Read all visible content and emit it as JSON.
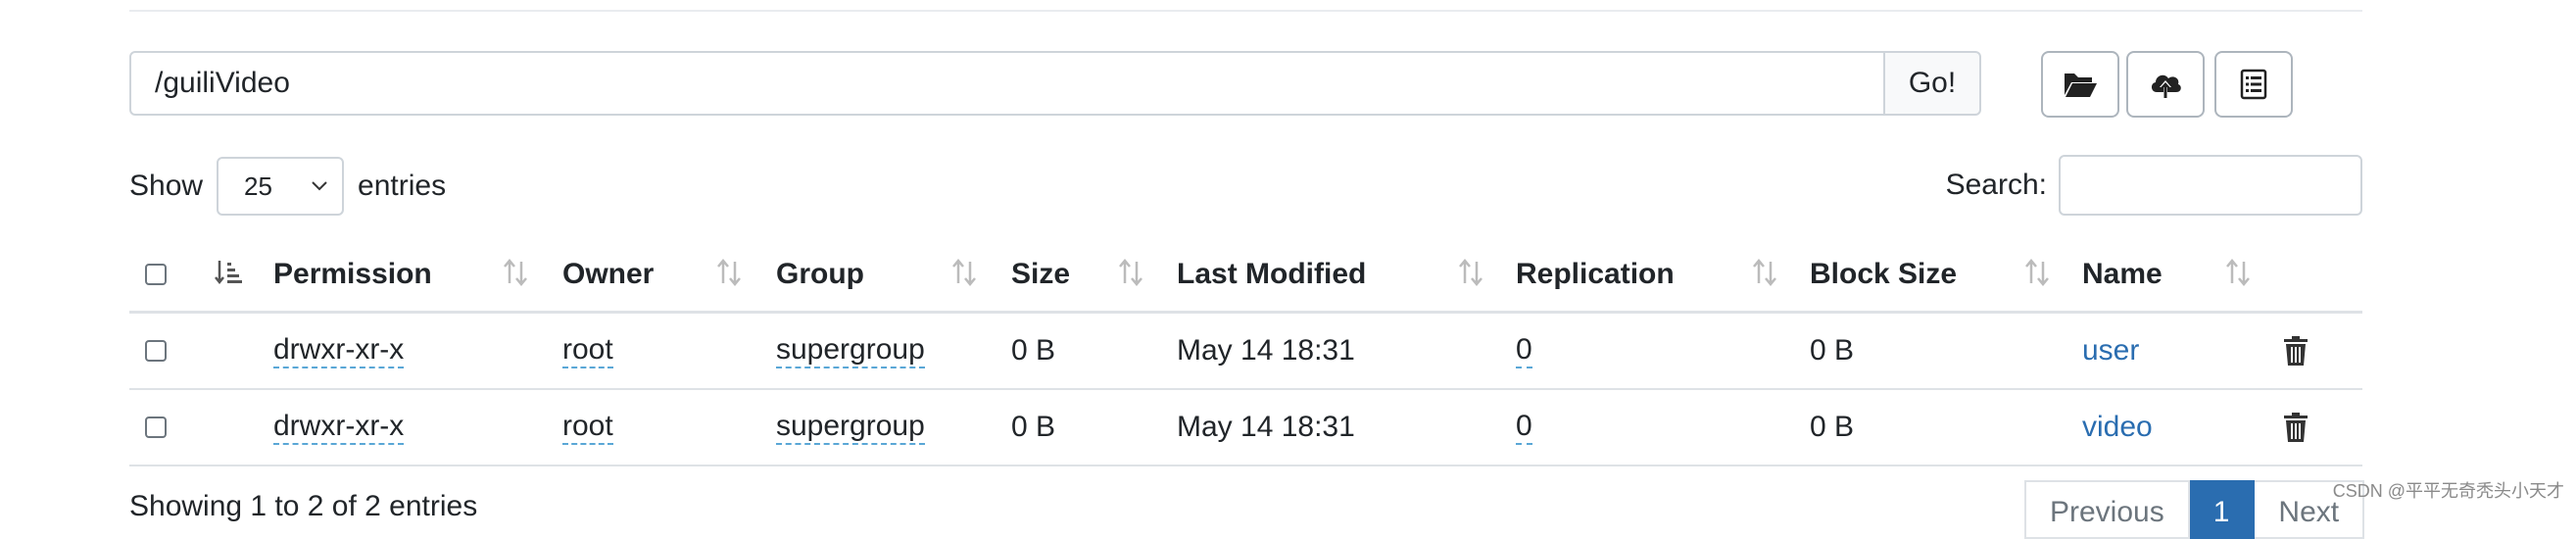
{
  "browser": {
    "path_value": "/guiliVideo",
    "go_label": "Go!"
  },
  "toolbar": {
    "icons": [
      "folder-open-icon",
      "cloud-upload-icon",
      "list-icon"
    ]
  },
  "length": {
    "show_label": "Show",
    "selected": "25",
    "entries_label": "entries"
  },
  "search": {
    "label": "Search:",
    "value": ""
  },
  "table": {
    "columns": [
      "Permission",
      "Owner",
      "Group",
      "Size",
      "Last Modified",
      "Replication",
      "Block Size",
      "Name"
    ],
    "rows": [
      {
        "permission": "drwxr-xr-x",
        "owner": "root",
        "group": "supergroup",
        "size": "0 B",
        "modified": "May 14 18:31",
        "replication": "0",
        "block_size": "0 B",
        "name": "user"
      },
      {
        "permission": "drwxr-xr-x",
        "owner": "root",
        "group": "supergroup",
        "size": "0 B",
        "modified": "May 14 18:31",
        "replication": "0",
        "block_size": "0 B",
        "name": "video"
      }
    ]
  },
  "footer": {
    "info": "Showing 1 to 2 of 2 entries",
    "prev": "Previous",
    "page": "1",
    "next": "Next"
  },
  "watermark": "CSDN @平平无奇秃头小天才",
  "colors": {
    "link": "#2a6db0",
    "active_page": "#2a6db0",
    "dotted_underline": "#5aa7d6"
  }
}
